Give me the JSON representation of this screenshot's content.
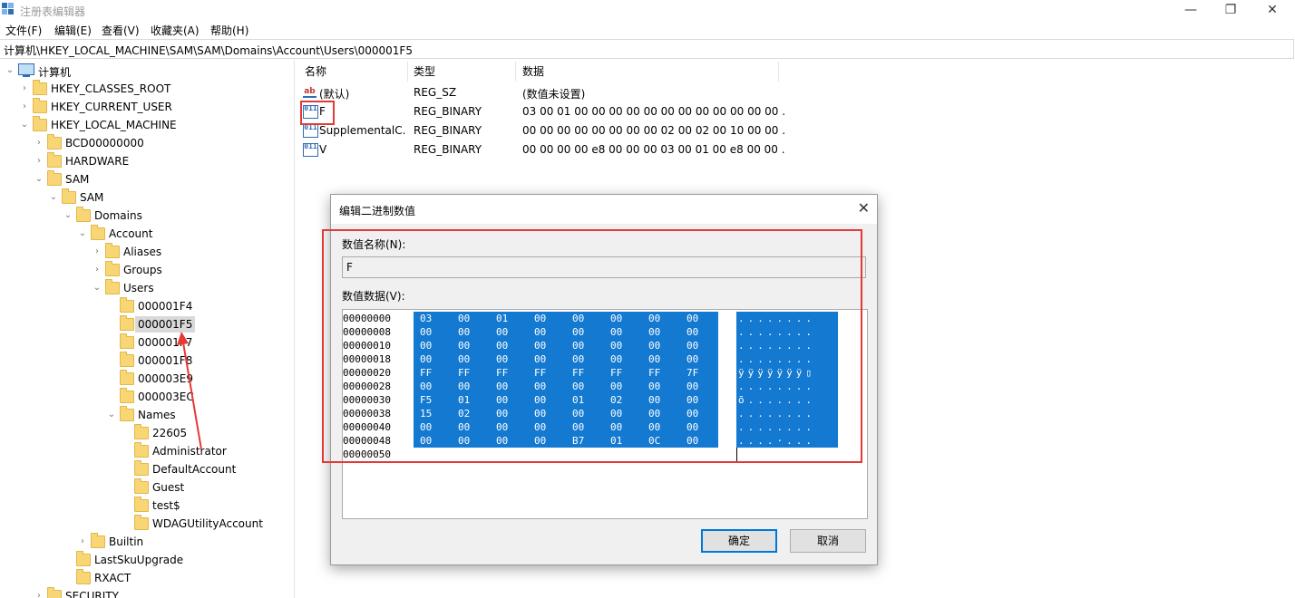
{
  "window": {
    "title": "注册表编辑器",
    "controls": [
      "—",
      "❐",
      "✕"
    ]
  },
  "menu": [
    "文件(F)",
    "编辑(E)",
    "查看(V)",
    "收藏夹(A)",
    "帮助(H)"
  ],
  "address": "计算机\\HKEY_LOCAL_MACHINE\\SAM\\SAM\\Domains\\Account\\Users\\000001F5",
  "tree": {
    "root": "计算机",
    "nodes": [
      {
        "label": "HKEY_CLASSES_ROOT",
        "chev": "›"
      },
      {
        "label": "HKEY_CURRENT_USER",
        "chev": "›"
      },
      {
        "label": "HKEY_LOCAL_MACHINE",
        "chev": "⌄"
      },
      {
        "label": "BCD00000000",
        "chev": "›"
      },
      {
        "label": "HARDWARE",
        "chev": "›"
      },
      {
        "label": "SAM",
        "chev": "⌄"
      },
      {
        "label": "SAM",
        "chev": "⌄"
      },
      {
        "label": "Domains",
        "chev": "⌄"
      },
      {
        "label": "Account",
        "chev": "⌄"
      },
      {
        "label": "Aliases",
        "chev": "›"
      },
      {
        "label": "Groups",
        "chev": "›"
      },
      {
        "label": "Users",
        "chev": "⌄"
      },
      {
        "label": "000001F4",
        "chev": ""
      },
      {
        "label": "000001F5",
        "chev": ""
      },
      {
        "label": "000001F7",
        "chev": ""
      },
      {
        "label": "000001F8",
        "chev": ""
      },
      {
        "label": "000003E9",
        "chev": ""
      },
      {
        "label": "000003EC",
        "chev": ""
      },
      {
        "label": "Names",
        "chev": "⌄"
      },
      {
        "label": "22605",
        "chev": ""
      },
      {
        "label": "Administrator",
        "chev": ""
      },
      {
        "label": "DefaultAccount",
        "chev": ""
      },
      {
        "label": "Guest",
        "chev": ""
      },
      {
        "label": "test$",
        "chev": ""
      },
      {
        "label": "WDAGUtilityAccount",
        "chev": ""
      },
      {
        "label": "Builtin",
        "chev": "›"
      },
      {
        "label": "LastSkuUpgrade",
        "chev": ""
      },
      {
        "label": "RXACT",
        "chev": ""
      },
      {
        "label": "SECURITY",
        "chev": "›"
      }
    ]
  },
  "list": {
    "columns": [
      "名称",
      "类型",
      "数据"
    ],
    "rows": [
      {
        "icon": "ab",
        "name": "(默认)",
        "type": "REG_SZ",
        "data": "(数值未设置)"
      },
      {
        "icon": "011",
        "name": "F",
        "type": "REG_BINARY",
        "data": "03 00 01 00 00 00 00 00 00 00 00 00 00 00 00 ..."
      },
      {
        "icon": "011",
        "name": "SupplementalC...",
        "type": "REG_BINARY",
        "data": "00 00 00 00 00 00 00 00 02 00 02 00 10 00 00 ..."
      },
      {
        "icon": "011",
        "name": "V",
        "type": "REG_BINARY",
        "data": "00 00 00 00 e8 00 00 00 03 00 01 00 e8 00 00 ..."
      }
    ]
  },
  "dialog": {
    "title": "编辑二进制数值",
    "name_label": "数值名称(N):",
    "name_value": "F",
    "data_label": "数值数据(V):",
    "ok": "确定",
    "cancel": "取消",
    "hex_rows": [
      {
        "addr": "00000000",
        "bytes": [
          "03",
          "00",
          "01",
          "00",
          "00",
          "00",
          "00",
          "00"
        ],
        "ascii": "........"
      },
      {
        "addr": "00000008",
        "bytes": [
          "00",
          "00",
          "00",
          "00",
          "00",
          "00",
          "00",
          "00"
        ],
        "ascii": "........"
      },
      {
        "addr": "00000010",
        "bytes": [
          "00",
          "00",
          "00",
          "00",
          "00",
          "00",
          "00",
          "00"
        ],
        "ascii": "........"
      },
      {
        "addr": "00000018",
        "bytes": [
          "00",
          "00",
          "00",
          "00",
          "00",
          "00",
          "00",
          "00"
        ],
        "ascii": "........"
      },
      {
        "addr": "00000020",
        "bytes": [
          "FF",
          "FF",
          "FF",
          "FF",
          "FF",
          "FF",
          "FF",
          "7F"
        ],
        "ascii": "ÿÿÿÿÿÿÿ▯"
      },
      {
        "addr": "00000028",
        "bytes": [
          "00",
          "00",
          "00",
          "00",
          "00",
          "00",
          "00",
          "00"
        ],
        "ascii": "........"
      },
      {
        "addr": "00000030",
        "bytes": [
          "F5",
          "01",
          "00",
          "00",
          "01",
          "02",
          "00",
          "00"
        ],
        "ascii": "õ......."
      },
      {
        "addr": "00000038",
        "bytes": [
          "15",
          "02",
          "00",
          "00",
          "00",
          "00",
          "00",
          "00"
        ],
        "ascii": "........"
      },
      {
        "addr": "00000040",
        "bytes": [
          "00",
          "00",
          "00",
          "00",
          "00",
          "00",
          "00",
          "00"
        ],
        "ascii": "........"
      },
      {
        "addr": "00000048",
        "bytes": [
          "00",
          "00",
          "00",
          "00",
          "B7",
          "01",
          "0C",
          "00"
        ],
        "ascii": "....·..."
      },
      {
        "addr": "00000050",
        "bytes": [],
        "ascii": ""
      }
    ]
  },
  "colors": {
    "selection": "#1479d1",
    "highlight": "#e53935",
    "folder": "#f8d675"
  }
}
